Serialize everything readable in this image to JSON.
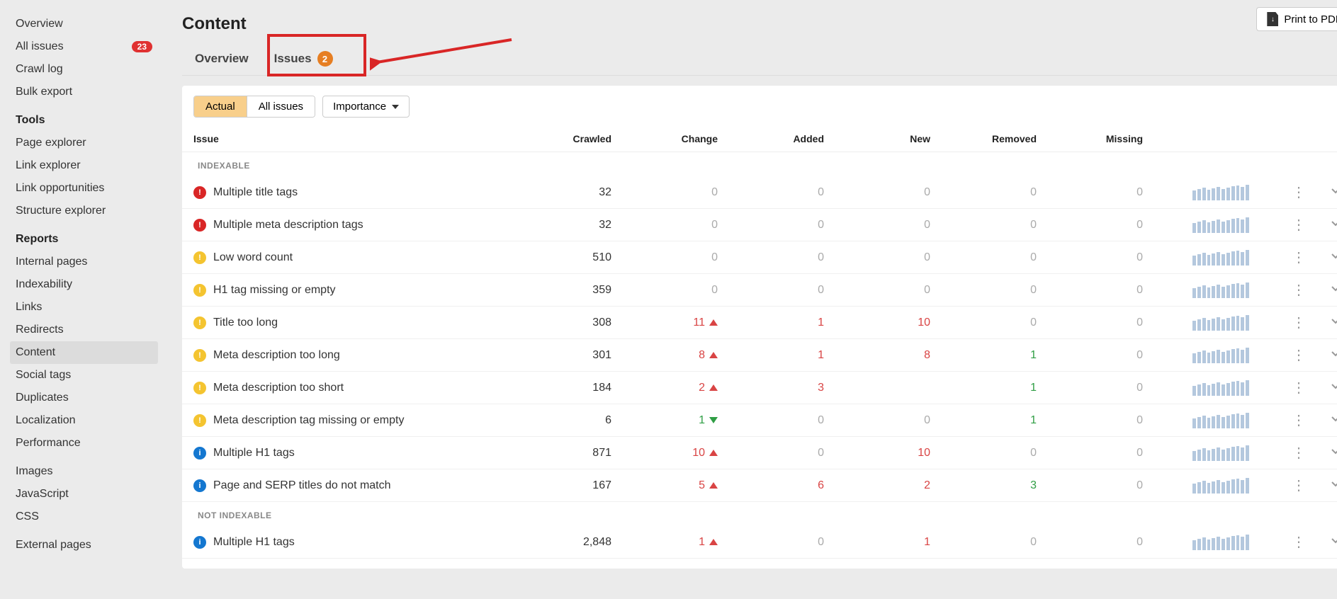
{
  "sidebar": {
    "groups": [
      {
        "heading": null,
        "items": [
          {
            "label": "Overview",
            "badge": null,
            "active": false
          },
          {
            "label": "All issues",
            "badge": "23",
            "active": false
          },
          {
            "label": "Crawl log",
            "badge": null,
            "active": false
          },
          {
            "label": "Bulk export",
            "badge": null,
            "active": false
          }
        ]
      },
      {
        "heading": "Tools",
        "items": [
          {
            "label": "Page explorer",
            "badge": null,
            "active": false
          },
          {
            "label": "Link explorer",
            "badge": null,
            "active": false
          },
          {
            "label": "Link opportunities",
            "badge": null,
            "active": false
          },
          {
            "label": "Structure explorer",
            "badge": null,
            "active": false
          }
        ]
      },
      {
        "heading": "Reports",
        "items": [
          {
            "label": "Internal pages",
            "badge": null,
            "active": false
          },
          {
            "label": "Indexability",
            "badge": null,
            "active": false
          },
          {
            "label": "Links",
            "badge": null,
            "active": false
          },
          {
            "label": "Redirects",
            "badge": null,
            "active": false
          },
          {
            "label": "Content",
            "badge": null,
            "active": true
          },
          {
            "label": "Social tags",
            "badge": null,
            "active": false
          },
          {
            "label": "Duplicates",
            "badge": null,
            "active": false
          },
          {
            "label": "Localization",
            "badge": null,
            "active": false
          },
          {
            "label": "Performance",
            "badge": null,
            "active": false
          }
        ]
      },
      {
        "heading": null,
        "items": [
          {
            "label": "Images",
            "badge": null,
            "active": false
          },
          {
            "label": "JavaScript",
            "badge": null,
            "active": false
          },
          {
            "label": "CSS",
            "badge": null,
            "active": false
          }
        ]
      },
      {
        "heading": null,
        "items": [
          {
            "label": "External pages",
            "badge": null,
            "active": false
          }
        ]
      }
    ]
  },
  "header": {
    "title": "Content",
    "print_label": "Print to PDF"
  },
  "tabs": [
    {
      "label": "Overview",
      "badge": null
    },
    {
      "label": "Issues",
      "badge": "2"
    }
  ],
  "toolbar": {
    "seg_actual": "Actual",
    "seg_all": "All issues",
    "dropdown_importance": "Importance"
  },
  "columns": {
    "issue": "Issue",
    "crawled": "Crawled",
    "change": "Change",
    "added": "Added",
    "new": "New",
    "removed": "Removed",
    "missing": "Missing"
  },
  "sections": [
    {
      "label": "INDEXABLE",
      "rows": [
        {
          "sev": "error",
          "name": "Multiple title tags",
          "crawled": "32",
          "change": "0",
          "change_dir": "none",
          "added": "0",
          "new": "0",
          "removed": "0",
          "missing": "0"
        },
        {
          "sev": "error",
          "name": "Multiple meta description tags",
          "crawled": "32",
          "change": "0",
          "change_dir": "none",
          "added": "0",
          "new": "0",
          "removed": "0",
          "missing": "0"
        },
        {
          "sev": "warn",
          "name": "Low word count",
          "crawled": "510",
          "change": "0",
          "change_dir": "none",
          "added": "0",
          "new": "0",
          "removed": "0",
          "missing": "0"
        },
        {
          "sev": "warn",
          "name": "H1 tag missing or empty",
          "crawled": "359",
          "change": "0",
          "change_dir": "none",
          "added": "0",
          "new": "0",
          "removed": "0",
          "missing": "0"
        },
        {
          "sev": "warn",
          "name": "Title too long",
          "crawled": "308",
          "change": "11",
          "change_dir": "up",
          "added": "1",
          "new": "10",
          "removed": "0",
          "missing": "0"
        },
        {
          "sev": "warn",
          "name": "Meta description too long",
          "crawled": "301",
          "change": "8",
          "change_dir": "up",
          "added": "1",
          "new": "8",
          "removed": "1",
          "missing": "0"
        },
        {
          "sev": "warn",
          "name": "Meta description too short",
          "crawled": "184",
          "change": "2",
          "change_dir": "up",
          "added": "3",
          "new": "",
          "removed": "1",
          "missing": "0"
        },
        {
          "sev": "warn",
          "name": "Meta description tag missing or empty",
          "crawled": "6",
          "change": "1",
          "change_dir": "down",
          "added": "0",
          "new": "0",
          "removed": "1",
          "missing": "0"
        },
        {
          "sev": "info",
          "name": "Multiple H1 tags",
          "crawled": "871",
          "change": "10",
          "change_dir": "up",
          "added": "0",
          "new": "10",
          "removed": "0",
          "missing": "0"
        },
        {
          "sev": "info",
          "name": "Page and SERP titles do not match",
          "crawled": "167",
          "change": "5",
          "change_dir": "up",
          "added": "6",
          "new": "2",
          "removed": "3",
          "missing": "0"
        }
      ]
    },
    {
      "label": "NOT INDEXABLE",
      "rows": [
        {
          "sev": "info",
          "name": "Multiple H1 tags",
          "crawled": "2,848",
          "change": "1",
          "change_dir": "up",
          "added": "0",
          "new": "1",
          "removed": "0",
          "missing": "0"
        }
      ]
    }
  ],
  "spark_heights": [
    14,
    16,
    18,
    15,
    17,
    19,
    16,
    18,
    20,
    21,
    19,
    22
  ]
}
